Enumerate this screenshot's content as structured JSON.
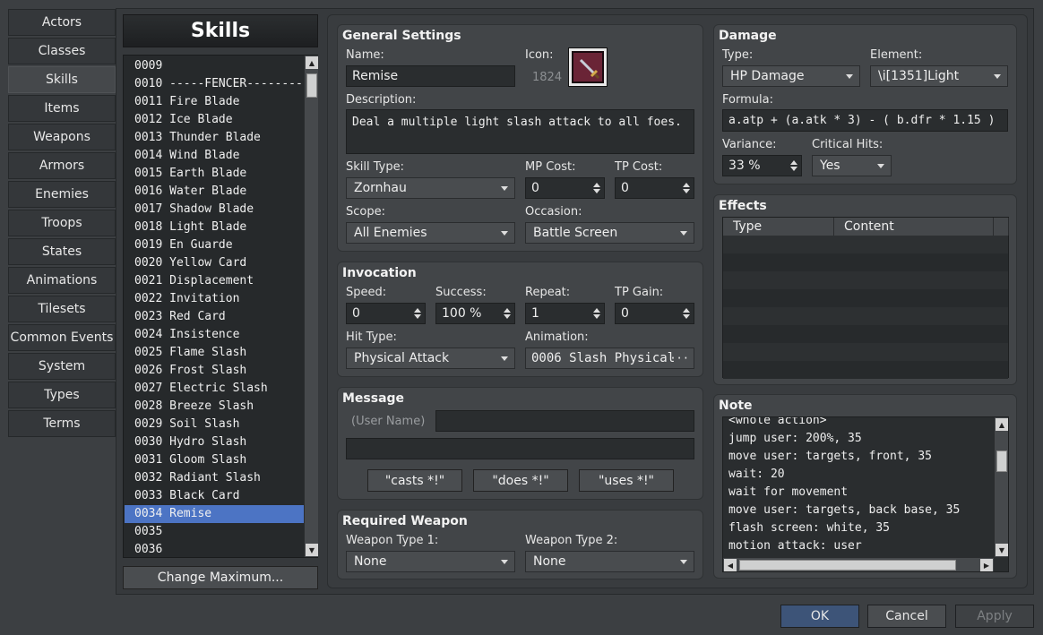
{
  "nav": [
    "Actors",
    "Classes",
    "Skills",
    "Items",
    "Weapons",
    "Armors",
    "Enemies",
    "Troops",
    "States",
    "Animations",
    "Tilesets",
    "Common Events",
    "System",
    "Types",
    "Terms"
  ],
  "nav_active": "Skills",
  "list": {
    "title": "Skills",
    "rows": [
      "0009",
      "0010 -----FENCER---------",
      "0011 Fire Blade",
      "0012 Ice Blade",
      "0013 Thunder Blade",
      "0014 Wind Blade",
      "0015 Earth Blade",
      "0016 Water Blade",
      "0017 Shadow Blade",
      "0018 Light Blade",
      "0019 En Guarde",
      "0020 Yellow Card",
      "0021 Displacement",
      "0022 Invitation",
      "0023 Red Card",
      "0024 Insistence",
      "0025 Flame Slash",
      "0026 Frost Slash",
      "0027 Electric Slash",
      "0028 Breeze Slash",
      "0029 Soil Slash",
      "0030 Hydro Slash",
      "0031 Gloom Slash",
      "0032 Radiant Slash",
      "0033 Black Card",
      "0034 Remise",
      "0035",
      "0036"
    ],
    "selected": "0034 Remise",
    "change_max": "Change Maximum..."
  },
  "general": {
    "title": "General Settings",
    "name_label": "Name:",
    "name_value": "Remise",
    "icon_label": "Icon:",
    "icon_index": "1824",
    "desc_label": "Description:",
    "desc_value": "Deal a multiple light slash attack to all foes.",
    "skilltype_label": "Skill Type:",
    "skilltype_value": "Zornhau",
    "mp_label": "MP Cost:",
    "mp_value": "0",
    "tp_label": "TP Cost:",
    "tp_value": "0",
    "scope_label": "Scope:",
    "scope_value": "All Enemies",
    "occasion_label": "Occasion:",
    "occasion_value": "Battle Screen"
  },
  "invocation": {
    "title": "Invocation",
    "speed_label": "Speed:",
    "speed_value": "0",
    "success_label": "Success:",
    "success_value": "100 %",
    "repeat_label": "Repeat:",
    "repeat_value": "1",
    "tpgain_label": "TP Gain:",
    "tpgain_value": "0",
    "hittype_label": "Hit Type:",
    "hittype_value": "Physical Attack",
    "animation_label": "Animation:",
    "animation_value": "0006 Slash Physical",
    "animation_more": "···"
  },
  "message": {
    "title": "Message",
    "user_name": "(User Name)",
    "line1": "",
    "line2": "",
    "btn_casts": "\"casts *!\"",
    "btn_does": "\"does *!\"",
    "btn_uses": "\"uses *!\""
  },
  "weapon": {
    "title": "Required Weapon",
    "type1_label": "Weapon Type 1:",
    "type1_value": "None",
    "type2_label": "Weapon Type 2:",
    "type2_value": "None"
  },
  "damage": {
    "title": "Damage",
    "type_label": "Type:",
    "type_value": "HP Damage",
    "element_label": "Element:",
    "element_value": "\\i[1351]Light",
    "formula_label": "Formula:",
    "formula_value": "a.atp + (a.atk * 3)  - ( b.dfr * 1.15 )",
    "variance_label": "Variance:",
    "variance_value": "33 %",
    "crit_label": "Critical Hits:",
    "crit_value": "Yes"
  },
  "effects": {
    "title": "Effects",
    "col_type": "Type",
    "col_content": "Content"
  },
  "note": {
    "title": "Note",
    "lines": [
      "<whole action>",
      "jump user: 200%, 35",
      "move user: targets, front, 35",
      "wait: 20",
      "wait for movement",
      "move user: targets, back base, 35",
      "flash screen: white, 35",
      "motion attack: user"
    ]
  },
  "dialog": {
    "ok": "OK",
    "cancel": "Cancel",
    "apply": "Apply"
  }
}
